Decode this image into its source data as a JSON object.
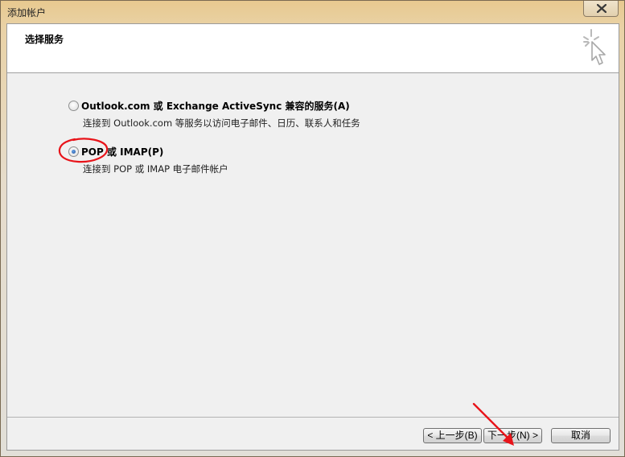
{
  "window": {
    "title": "添加帐户"
  },
  "header": {
    "title": "选择服务",
    "icon": "wizard-cursor-icon"
  },
  "options": [
    {
      "label": "Outlook.com 或 Exchange ActiveSync 兼容的服务(A)",
      "description": "连接到 Outlook.com 等服务以访问电子邮件、日历、联系人和任务",
      "selected": false
    },
    {
      "label": "POP 或 IMAP(P)",
      "description": "连接到 POP 或 IMAP 电子邮件帐户",
      "selected": true
    }
  ],
  "buttons": {
    "back": "< 上一步(B)",
    "next": "下一步(N) >",
    "cancel": "取消"
  },
  "annotations": {
    "highlight_color": "#e8141a"
  }
}
